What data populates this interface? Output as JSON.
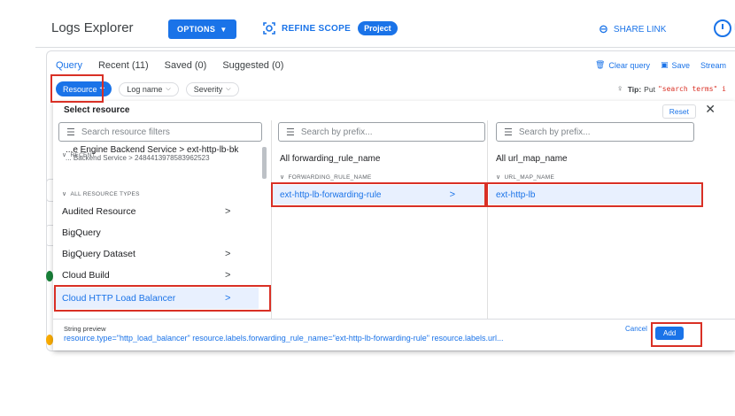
{
  "header": {
    "title": "Logs Explorer",
    "options_label": "OPTIONS",
    "refine_label": "REFINE SCOPE",
    "project_badge": "Project",
    "share_label": "SHARE LINK",
    "clock_letter": "L"
  },
  "query_tabs": [
    {
      "label": "Query",
      "active": true
    },
    {
      "label": "Recent (11)",
      "active": false
    },
    {
      "label": "Saved (0)",
      "active": false
    },
    {
      "label": "Suggested (0)",
      "active": false
    }
  ],
  "query_actions": {
    "clear_label": "Clear query",
    "save_label": "Save",
    "stream_label": "Stream"
  },
  "chips": {
    "resource_label": "Resource",
    "logname_label": "Log name",
    "severity_label": "Severity"
  },
  "tip": {
    "prefix": "Tip:",
    "text": "Put",
    "code": "\"search terms\" i"
  },
  "dropdown": {
    "title": "Select resource",
    "reset_label": "Reset",
    "close_label": "✕",
    "resource_search_placeholder": "Search resource filters",
    "prefix_search_placeholder": "Search by prefix...",
    "recent_header": "RECENT",
    "recent_item": {
      "title": "...e Engine Backend Service > ext-http-lb-bk",
      "subtitle": "... Backend Service > 2484413978583962523"
    },
    "all_types_header": "ALL RESOURCE TYPES",
    "resource_types": [
      {
        "label": "Audited Resource",
        "has_children": true,
        "selected": false
      },
      {
        "label": "BigQuery",
        "has_children": false,
        "selected": false
      },
      {
        "label": "BigQuery Dataset",
        "has_children": true,
        "selected": false
      },
      {
        "label": "Cloud Build",
        "has_children": true,
        "selected": false
      },
      {
        "label": "Cloud HTTP Load Balancer",
        "has_children": true,
        "selected": true
      }
    ],
    "forwarding_column": {
      "heading": "All forwarding_rule_name",
      "section_header": "FORWARDING_RULE_NAME",
      "value": "ext-http-lb-forwarding-rule"
    },
    "urlmap_column": {
      "heading": "All url_map_name",
      "section_header": "URL_MAP_NAME",
      "value": "ext-http-lb"
    },
    "preview": {
      "label": "String preview",
      "string": "resource.type=\"http_load_balancer\" resource.labels.forwarding_rule_name=\"ext-http-lb-forwarding-rule\" resource.labels.url...",
      "cancel_label": "Cancel",
      "add_label": "Add"
    }
  },
  "background_fragments": {
    "bigquery_partial": "Big"
  },
  "colors": {
    "accent": "#1a73e8",
    "highlight": "#d93025",
    "selected_bg": "#e8f0fe"
  }
}
